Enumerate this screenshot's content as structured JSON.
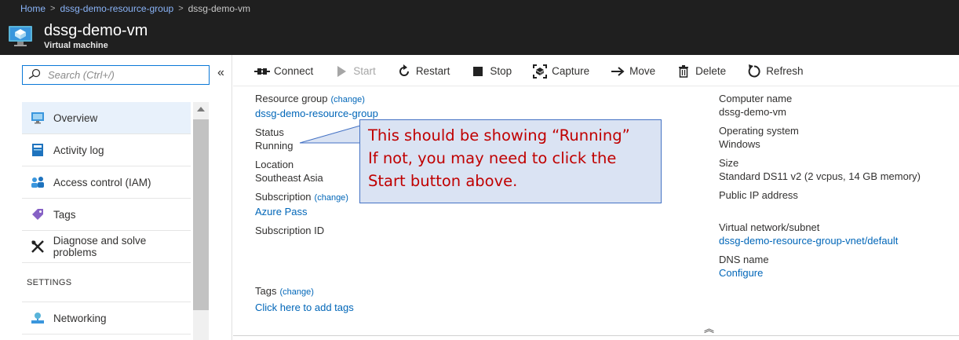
{
  "breadcrumb": {
    "home": "Home",
    "resource_group": "dssg-demo-resource-group",
    "current": "dssg-demo-vm"
  },
  "header": {
    "title": "dssg-demo-vm",
    "subtitle": "Virtual machine"
  },
  "sidebar": {
    "search_placeholder": "Search (Ctrl+/)",
    "collapse_glyph": "«",
    "items": [
      {
        "label": "Overview",
        "icon": "monitor-icon",
        "active": true
      },
      {
        "label": "Activity log",
        "icon": "activity-log-icon"
      },
      {
        "label": "Access control (IAM)",
        "icon": "people-icon"
      },
      {
        "label": "Tags",
        "icon": "tag-icon"
      },
      {
        "label": "Diagnose and solve problems",
        "icon": "wrench-icon"
      }
    ],
    "section_settings": "SETTINGS",
    "settings_items": [
      {
        "label": "Networking",
        "icon": "network-icon"
      }
    ]
  },
  "toolbar": {
    "connect": "Connect",
    "start": "Start",
    "restart": "Restart",
    "stop": "Stop",
    "capture": "Capture",
    "move": "Move",
    "delete": "Delete",
    "refresh": "Refresh"
  },
  "essentials": {
    "resource_group_label": "Resource group",
    "change": "(change)",
    "resource_group_value": "dssg-demo-resource-group",
    "status_label": "Status",
    "status_value": "Running",
    "location_label": "Location",
    "location_value": "Southeast Asia",
    "subscription_label": "Subscription",
    "subscription_value": "Azure Pass",
    "subscription_id_label": "Subscription ID",
    "computer_name_label": "Computer name",
    "computer_name_value": "dssg-demo-vm",
    "os_label": "Operating system",
    "os_value": "Windows",
    "size_label": "Size",
    "size_value": "Standard DS11 v2 (2 vcpus, 14 GB memory)",
    "public_ip_label": "Public IP address",
    "vnet_label": "Virtual network/subnet",
    "vnet_value": "dssg-demo-resource-group-vnet/default",
    "dns_label": "DNS name",
    "dns_value": "Configure",
    "tags_label": "Tags",
    "tags_link": "Click here to add tags",
    "collapse_glyph": "︽"
  },
  "callout": {
    "line1": "This should be showing “Running”",
    "line2": "If not, you may need to click the",
    "line3": "Start button above."
  },
  "colors": {
    "header_bg": "#1f1f1f",
    "link": "#0066b8",
    "callout_bg": "#dae3f3",
    "callout_border": "#4472c4",
    "callout_text": "#c00000"
  }
}
